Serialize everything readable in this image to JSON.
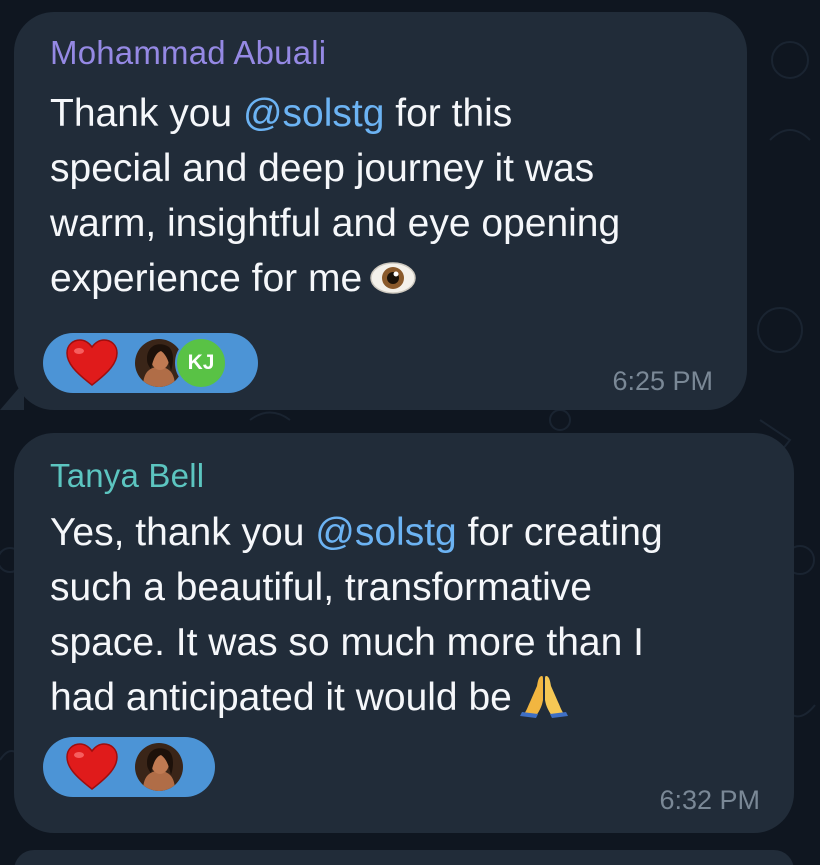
{
  "chat": {
    "background_color": "#0f1620",
    "bubble_color": "#212c39"
  },
  "messages": [
    {
      "sender": "Mohammad Abuali",
      "sender_color": "#9589e4",
      "text_before": "Thank you ",
      "mention": "@solstg",
      "text_line1_after": " for this",
      "line2": "special and deep journey it was",
      "line3": "warm, insightful and eye opening",
      "line4": "experience for me",
      "emoji": "eye-emoji",
      "reactions": {
        "emoji": "red-heart",
        "reactors": [
          "photo-avatar",
          "KJ"
        ]
      },
      "time": "6:25 PM"
    },
    {
      "sender": "Tanya Bell",
      "sender_color": "#5cc5c0",
      "text_before": "Yes, thank you ",
      "mention": "@solstg",
      "text_line1_after": " for creating",
      "line2": "such a beautiful, transformative",
      "line3": "space. It was so much more than I",
      "line4": "had anticipated it would be",
      "emoji": "folded-hands-emoji",
      "reactions": {
        "emoji": "red-heart",
        "reactors": [
          "photo-avatar"
        ]
      },
      "time": "6:32 PM"
    }
  ]
}
